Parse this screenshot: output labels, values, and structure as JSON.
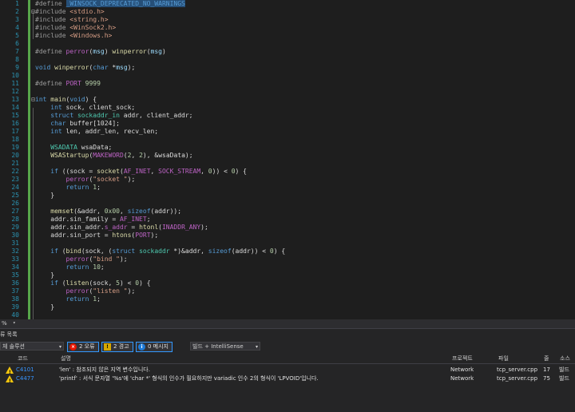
{
  "editor": {
    "lines": [
      {
        "n": "1",
        "tokens": [
          {
            "t": "#define ",
            "c": "t-pp"
          },
          {
            "t": "_WINSOCK_DEPRECATED_NO_WARNINGS",
            "c": "t-sel"
          }
        ]
      },
      {
        "n": "2",
        "tokens": [
          {
            "t": "#include ",
            "c": "t-pp"
          },
          {
            "t": "<stdio.h>",
            "c": "t-str"
          }
        ]
      },
      {
        "n": "3",
        "tokens": [
          {
            "t": "#include ",
            "c": "t-pp"
          },
          {
            "t": "<string.h>",
            "c": "t-str"
          }
        ]
      },
      {
        "n": "4",
        "tokens": [
          {
            "t": "#include ",
            "c": "t-pp"
          },
          {
            "t": "<WinSock2.h>",
            "c": "t-str"
          }
        ]
      },
      {
        "n": "5",
        "tokens": [
          {
            "t": "#include ",
            "c": "t-pp"
          },
          {
            "t": "<Windows.h>",
            "c": "t-str"
          }
        ]
      },
      {
        "n": "6",
        "tokens": []
      },
      {
        "n": "7",
        "tokens": [
          {
            "t": "#define ",
            "c": "t-pp"
          },
          {
            "t": "perror",
            "c": "t-mac"
          },
          {
            "t": "(",
            "c": "t-id"
          },
          {
            "t": "msg",
            "c": "t-var"
          },
          {
            "t": ") ",
            "c": "t-id"
          },
          {
            "t": "winperror",
            "c": "t-fn"
          },
          {
            "t": "(",
            "c": "t-id"
          },
          {
            "t": "msg",
            "c": "t-var"
          },
          {
            "t": ")",
            "c": "t-id"
          }
        ]
      },
      {
        "n": "8",
        "tokens": []
      },
      {
        "n": "9",
        "tokens": [
          {
            "t": "void ",
            "c": "t-kw"
          },
          {
            "t": "winperror",
            "c": "t-fn"
          },
          {
            "t": "(",
            "c": "t-id"
          },
          {
            "t": "char ",
            "c": "t-kw"
          },
          {
            "t": "*",
            "c": "t-id"
          },
          {
            "t": "msg",
            "c": "t-var"
          },
          {
            "t": ");",
            "c": "t-id"
          }
        ]
      },
      {
        "n": "10",
        "tokens": []
      },
      {
        "n": "11",
        "tokens": [
          {
            "t": "#define ",
            "c": "t-pp"
          },
          {
            "t": "PORT ",
            "c": "t-mac"
          },
          {
            "t": "9999",
            "c": "t-num"
          }
        ]
      },
      {
        "n": "12",
        "tokens": []
      },
      {
        "n": "13",
        "tokens": [
          {
            "t": "int ",
            "c": "t-kw"
          },
          {
            "t": "main",
            "c": "t-fn"
          },
          {
            "t": "(",
            "c": "t-id"
          },
          {
            "t": "void",
            "c": "t-kw"
          },
          {
            "t": ") {",
            "c": "t-id"
          }
        ]
      },
      {
        "n": "14",
        "tokens": [
          {
            "t": "    ",
            "c": "t-id"
          },
          {
            "t": "int ",
            "c": "t-kw"
          },
          {
            "t": "sock, client_sock;",
            "c": "t-id"
          }
        ]
      },
      {
        "n": "15",
        "tokens": [
          {
            "t": "    ",
            "c": "t-id"
          },
          {
            "t": "struct ",
            "c": "t-kw"
          },
          {
            "t": "sockaddr_in ",
            "c": "t-ty"
          },
          {
            "t": "addr, client_addr;",
            "c": "t-id"
          }
        ]
      },
      {
        "n": "16",
        "tokens": [
          {
            "t": "    ",
            "c": "t-id"
          },
          {
            "t": "char ",
            "c": "t-kw"
          },
          {
            "t": "buffer[1024];",
            "c": "t-id"
          }
        ]
      },
      {
        "n": "17",
        "tokens": [
          {
            "t": "    ",
            "c": "t-id"
          },
          {
            "t": "int ",
            "c": "t-kw"
          },
          {
            "t": "len, addr_len, recv_len;",
            "c": "t-id"
          }
        ]
      },
      {
        "n": "18",
        "tokens": []
      },
      {
        "n": "19",
        "tokens": [
          {
            "t": "    ",
            "c": "t-id"
          },
          {
            "t": "WSADATA ",
            "c": "t-ty"
          },
          {
            "t": "wsaData;",
            "c": "t-id"
          }
        ]
      },
      {
        "n": "20",
        "tokens": [
          {
            "t": "    ",
            "c": "t-id"
          },
          {
            "t": "WSAStartup",
            "c": "t-fn"
          },
          {
            "t": "(",
            "c": "t-id"
          },
          {
            "t": "MAKEWORD",
            "c": "t-mac"
          },
          {
            "t": "(",
            "c": "t-id"
          },
          {
            "t": "2",
            "c": "t-num"
          },
          {
            "t": ", ",
            "c": "t-id"
          },
          {
            "t": "2",
            "c": "t-num"
          },
          {
            "t": "), &wsaData);",
            "c": "t-id"
          }
        ]
      },
      {
        "n": "21",
        "tokens": []
      },
      {
        "n": "22",
        "tokens": [
          {
            "t": "    ",
            "c": "t-id"
          },
          {
            "t": "if ",
            "c": "t-kw"
          },
          {
            "t": "((sock = ",
            "c": "t-id"
          },
          {
            "t": "socket",
            "c": "t-fn"
          },
          {
            "t": "(",
            "c": "t-id"
          },
          {
            "t": "AF_INET",
            "c": "t-mac"
          },
          {
            "t": ", ",
            "c": "t-id"
          },
          {
            "t": "SOCK_STREAM",
            "c": "t-mac"
          },
          {
            "t": ", ",
            "c": "t-id"
          },
          {
            "t": "0",
            "c": "t-num"
          },
          {
            "t": ")) < ",
            "c": "t-id"
          },
          {
            "t": "0",
            "c": "t-num"
          },
          {
            "t": ") {",
            "c": "t-id"
          }
        ]
      },
      {
        "n": "23",
        "tokens": [
          {
            "t": "        ",
            "c": "t-id"
          },
          {
            "t": "perror",
            "c": "t-mac"
          },
          {
            "t": "(",
            "c": "t-id"
          },
          {
            "t": "\"socket \"",
            "c": "t-str"
          },
          {
            "t": ");",
            "c": "t-id"
          }
        ]
      },
      {
        "n": "24",
        "tokens": [
          {
            "t": "        ",
            "c": "t-id"
          },
          {
            "t": "return ",
            "c": "t-kw"
          },
          {
            "t": "1",
            "c": "t-num"
          },
          {
            "t": ";",
            "c": "t-id"
          }
        ]
      },
      {
        "n": "25",
        "tokens": [
          {
            "t": "    }",
            "c": "t-id"
          }
        ]
      },
      {
        "n": "26",
        "tokens": []
      },
      {
        "n": "27",
        "tokens": [
          {
            "t": "    ",
            "c": "t-id"
          },
          {
            "t": "memset",
            "c": "t-fn"
          },
          {
            "t": "(&addr, ",
            "c": "t-id"
          },
          {
            "t": "0x00",
            "c": "t-num"
          },
          {
            "t": ", ",
            "c": "t-id"
          },
          {
            "t": "sizeof",
            "c": "t-kw"
          },
          {
            "t": "(addr));",
            "c": "t-id"
          }
        ]
      },
      {
        "n": "28",
        "tokens": [
          {
            "t": "    addr.sin_family = ",
            "c": "t-id"
          },
          {
            "t": "AF_INET",
            "c": "t-mac"
          },
          {
            "t": ";",
            "c": "t-id"
          }
        ]
      },
      {
        "n": "29",
        "tokens": [
          {
            "t": "    addr.sin_addr.",
            "c": "t-id"
          },
          {
            "t": "s_addr",
            "c": "t-mac"
          },
          {
            "t": " = ",
            "c": "t-id"
          },
          {
            "t": "htonl",
            "c": "t-fn"
          },
          {
            "t": "(",
            "c": "t-id"
          },
          {
            "t": "INADDR_ANY",
            "c": "t-mac"
          },
          {
            "t": ");",
            "c": "t-id"
          }
        ]
      },
      {
        "n": "30",
        "tokens": [
          {
            "t": "    addr.sin_port = ",
            "c": "t-id"
          },
          {
            "t": "htons",
            "c": "t-fn"
          },
          {
            "t": "(",
            "c": "t-id"
          },
          {
            "t": "PORT",
            "c": "t-mac"
          },
          {
            "t": ");",
            "c": "t-id"
          }
        ]
      },
      {
        "n": "31",
        "tokens": []
      },
      {
        "n": "32",
        "tokens": [
          {
            "t": "    ",
            "c": "t-id"
          },
          {
            "t": "if ",
            "c": "t-kw"
          },
          {
            "t": "(",
            "c": "t-id"
          },
          {
            "t": "bind",
            "c": "t-fn"
          },
          {
            "t": "(sock, (",
            "c": "t-id"
          },
          {
            "t": "struct ",
            "c": "t-kw"
          },
          {
            "t": "sockaddr ",
            "c": "t-ty"
          },
          {
            "t": "*)&addr, ",
            "c": "t-id"
          },
          {
            "t": "sizeof",
            "c": "t-kw"
          },
          {
            "t": "(addr)) < ",
            "c": "t-id"
          },
          {
            "t": "0",
            "c": "t-num"
          },
          {
            "t": ") {",
            "c": "t-id"
          }
        ]
      },
      {
        "n": "33",
        "tokens": [
          {
            "t": "        ",
            "c": "t-id"
          },
          {
            "t": "perror",
            "c": "t-mac"
          },
          {
            "t": "(",
            "c": "t-id"
          },
          {
            "t": "\"bind \"",
            "c": "t-str"
          },
          {
            "t": ");",
            "c": "t-id"
          }
        ]
      },
      {
        "n": "34",
        "tokens": [
          {
            "t": "        ",
            "c": "t-id"
          },
          {
            "t": "return ",
            "c": "t-kw"
          },
          {
            "t": "10",
            "c": "t-num"
          },
          {
            "t": ";",
            "c": "t-id"
          }
        ]
      },
      {
        "n": "35",
        "tokens": [
          {
            "t": "    }",
            "c": "t-id"
          }
        ]
      },
      {
        "n": "36",
        "tokens": [
          {
            "t": "    ",
            "c": "t-id"
          },
          {
            "t": "if ",
            "c": "t-kw"
          },
          {
            "t": "(",
            "c": "t-id"
          },
          {
            "t": "listen",
            "c": "t-fn"
          },
          {
            "t": "(sock, ",
            "c": "t-id"
          },
          {
            "t": "5",
            "c": "t-num"
          },
          {
            "t": ") < ",
            "c": "t-id"
          },
          {
            "t": "0",
            "c": "t-num"
          },
          {
            "t": ") {",
            "c": "t-id"
          }
        ]
      },
      {
        "n": "37",
        "tokens": [
          {
            "t": "        ",
            "c": "t-id"
          },
          {
            "t": "perror",
            "c": "t-mac"
          },
          {
            "t": "(",
            "c": "t-id"
          },
          {
            "t": "\"listen \"",
            "c": "t-str"
          },
          {
            "t": ");",
            "c": "t-id"
          }
        ]
      },
      {
        "n": "38",
        "tokens": [
          {
            "t": "        ",
            "c": "t-id"
          },
          {
            "t": "return ",
            "c": "t-kw"
          },
          {
            "t": "1",
            "c": "t-num"
          },
          {
            "t": ";",
            "c": "t-id"
          }
        ]
      },
      {
        "n": "39",
        "tokens": [
          {
            "t": "    }",
            "c": "t-id"
          }
        ]
      },
      {
        "n": "40",
        "tokens": []
      }
    ]
  },
  "zoom": {
    "value": "%",
    "arrow": "▾"
  },
  "error_list": {
    "title": "류 목록",
    "scope_select": "체 솔루션",
    "errors_btn": "2 오류",
    "warnings_btn": "2 경고",
    "messages_btn": "0 메시지",
    "build_select": "빌드 + IntelliSense",
    "headers": {
      "code": "코드",
      "desc": "설명",
      "project": "프로젝트",
      "file": "파일",
      "line": "줄",
      "source": "소스"
    },
    "rows": [
      {
        "code": "C4101",
        "desc": "'len' : 참조되지 않은 지역 변수입니다.",
        "project": "Network",
        "file": "tcp_server.cpp",
        "line": "17",
        "source": "빌드"
      },
      {
        "code": "C4477",
        "desc": "'printf' : 서식 문자열 '%s'에 'char *' 형식의 인수가 필요하지만 variadic 인수 2의 형식이 'LPVOID'입니다.",
        "project": "Network",
        "file": "tcp_server.cpp",
        "line": "75",
        "source": "빌드"
      }
    ]
  }
}
